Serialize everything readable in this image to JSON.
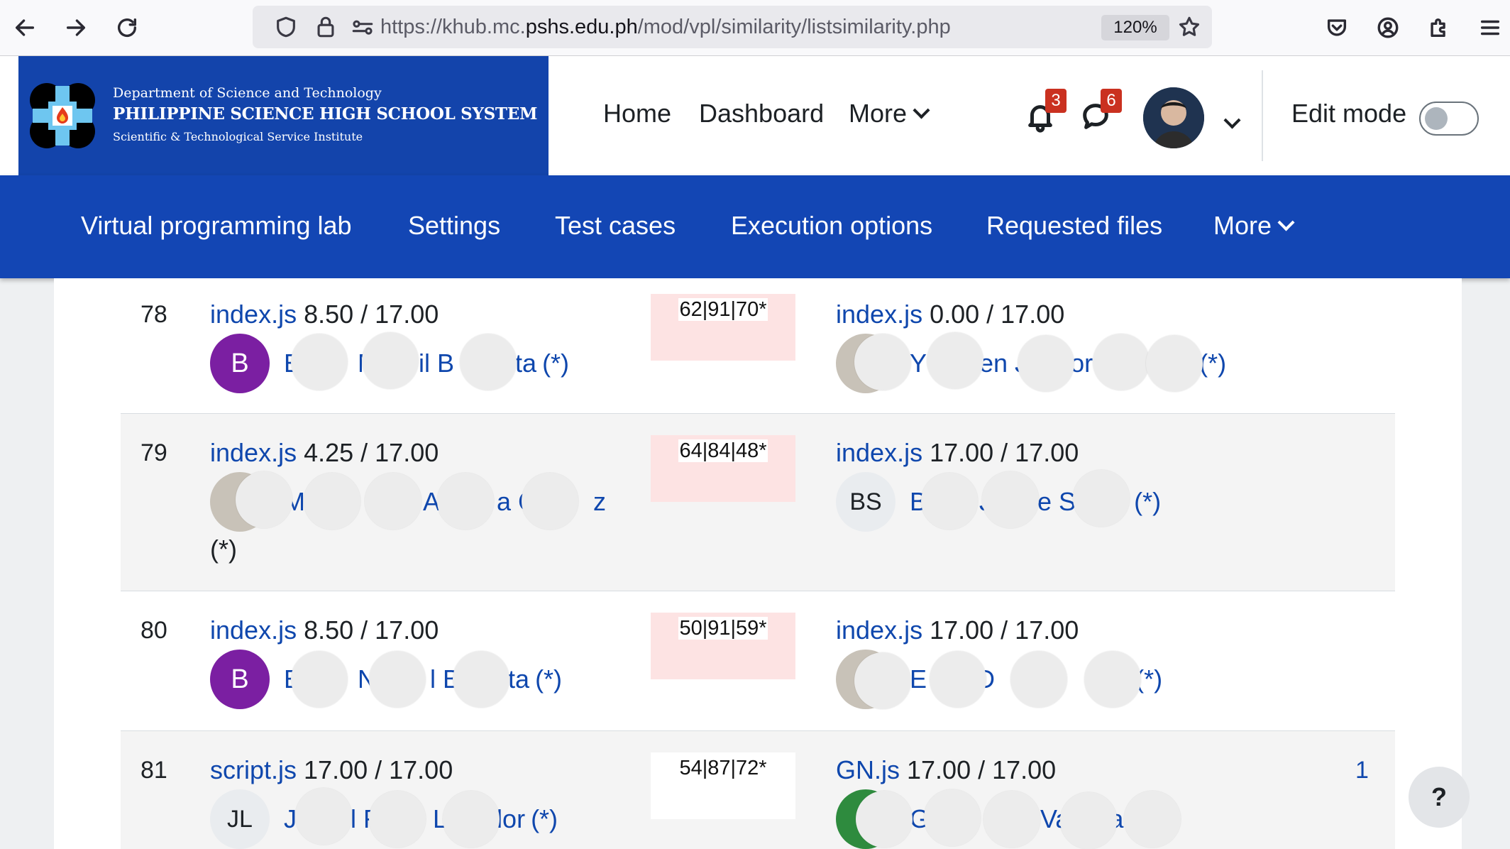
{
  "browser": {
    "url_prefix": "https://khub.mc.",
    "url_domain": "pshs.edu.ph",
    "url_path": "/mod/vpl/similarity/listsimilarity.php",
    "zoom": "120%"
  },
  "header": {
    "logo": {
      "line1": "Department of Science and Technology",
      "line2": "PHILIPPINE SCIENCE HIGH SCHOOL SYSTEM",
      "line3": "Scientific & Technological Service Institute"
    },
    "nav": {
      "home": "Home",
      "dashboard": "Dashboard",
      "more": "More"
    },
    "notifications_count": "3",
    "messages_count": "6",
    "edit_mode_label": "Edit mode"
  },
  "secondary_nav": {
    "items": [
      "Virtual programming lab",
      "Settings",
      "Test cases",
      "Execution options",
      "Requested files",
      "More"
    ]
  },
  "rows": [
    {
      "num": "78",
      "left": {
        "file": "index.js",
        "grade": "8.50 / 17.00",
        "avatar": "B",
        "name_fragments": [
          "E",
          "N",
          "il B",
          "ta",
          "(*)"
        ]
      },
      "similarity": "62|91|70*",
      "right": {
        "file": "index.js",
        "grade": "0.00 / 17.00",
        "name_fragments": [
          "Y",
          "en J",
          "or",
          "(*)"
        ]
      }
    },
    {
      "num": "79",
      "left": {
        "file": "index.js",
        "grade": "4.25 / 17.00",
        "name_fragments": [
          "M",
          "A",
          "a C",
          "z"
        ],
        "trailing": "(*)"
      },
      "similarity": "64|84|48*",
      "right": {
        "file": "index.js",
        "grade": "17.00 / 17.00",
        "avatar": "BS",
        "name_fragments": [
          "B",
          "J",
          "ne S",
          "s",
          "(*)"
        ]
      }
    },
    {
      "num": "80",
      "left": {
        "file": "index.js",
        "grade": "8.50 / 17.00",
        "avatar": "B",
        "name_fragments": [
          "E",
          "N",
          "l B",
          "ta",
          "(*)"
        ]
      },
      "similarity": "50|91|59*",
      "right": {
        "file": "index.js",
        "grade": "17.00 / 17.00",
        "name_fragments": [
          "E",
          "D",
          "De",
          "uz",
          "(*)"
        ]
      }
    },
    {
      "num": "81",
      "left": {
        "file": "script.js",
        "grade": "17.00 / 17.00",
        "avatar": "JL",
        "name_fragments": [
          "J",
          "l F",
          "La",
          "lor",
          "(*)"
        ]
      },
      "similarity": "54|87|72*",
      "right": {
        "file": "GN.js",
        "grade": "17.00 / 17.00",
        "name_fragments": [
          "G",
          "Va",
          "a",
          "*)"
        ]
      },
      "extra": "1"
    }
  ],
  "help_label": "?"
}
